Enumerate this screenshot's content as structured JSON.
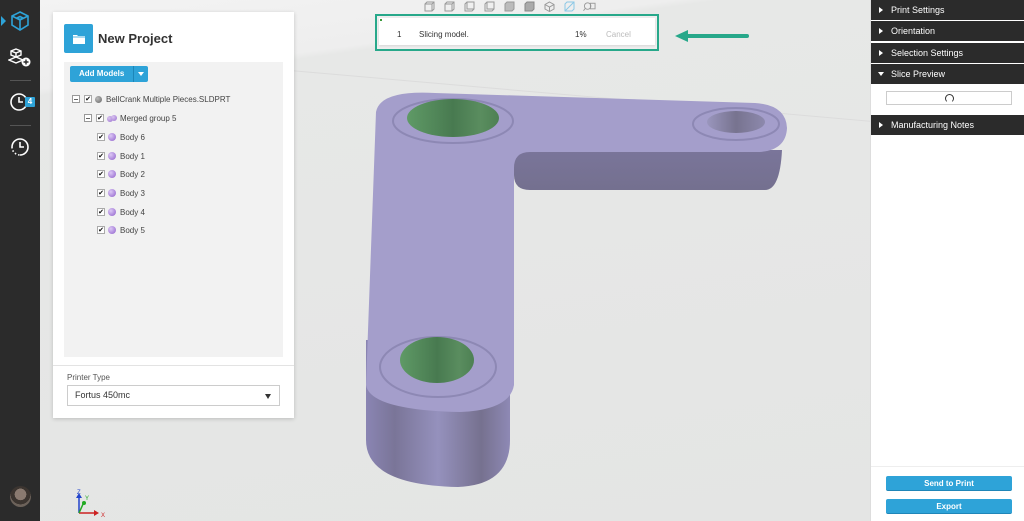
{
  "nav_rail": {
    "items": [
      {
        "name": "model-view",
        "icon": "cube-icon",
        "active": true
      },
      {
        "name": "add-model",
        "icon": "add-part-icon"
      },
      {
        "name": "print-queue",
        "icon": "clock-icon",
        "badge": "4"
      },
      {
        "name": "history",
        "icon": "history-icon"
      }
    ],
    "accent_color": "#2ea3d8"
  },
  "project": {
    "title": "New Project",
    "add_models_label": "Add Models",
    "tree": {
      "root": {
        "label": "BellCrank Multiple Pieces.SLDPRT",
        "checked": true,
        "expanded": true
      },
      "group": {
        "label": "Merged group 5",
        "checked": true,
        "expanded": true
      },
      "bodies": [
        {
          "label": "Body 6",
          "checked": true
        },
        {
          "label": "Body 1",
          "checked": true
        },
        {
          "label": "Body 2",
          "checked": true
        },
        {
          "label": "Body 3",
          "checked": true
        },
        {
          "label": "Body 4",
          "checked": true
        },
        {
          "label": "Body 5",
          "checked": true
        }
      ]
    },
    "printer_type_label": "Printer Type",
    "printer_type_value": "Fortus 450mc"
  },
  "view_toolbar": {
    "buttons": [
      "front-view-icon",
      "back-view-icon",
      "left-view-icon",
      "right-view-icon",
      "top-view-icon",
      "bottom-view-icon",
      "iso-view-icon",
      "perspective-view-icon",
      "zoom-fit-icon"
    ]
  },
  "progress": {
    "index": "1",
    "message": "Slicing model.",
    "percent": "1%",
    "percent_value": 1,
    "cancel_label": "Cancel",
    "highlight_color": "#27a88a"
  },
  "axis_triad": {
    "x": "X",
    "y": "Y",
    "z": "Z"
  },
  "right_panel": {
    "sections": [
      {
        "label": "Print Settings",
        "expanded": false
      },
      {
        "label": "Orientation",
        "expanded": false
      },
      {
        "label": "Selection Settings",
        "expanded": false
      },
      {
        "label": "Slice Preview",
        "expanded": true
      },
      {
        "label": "Manufacturing Notes",
        "expanded": false
      }
    ],
    "send_to_print_label": "Send to Print",
    "export_label": "Export"
  },
  "model": {
    "body_color": "#a49ecb",
    "selected_hole_color": "#5a8a5e"
  }
}
